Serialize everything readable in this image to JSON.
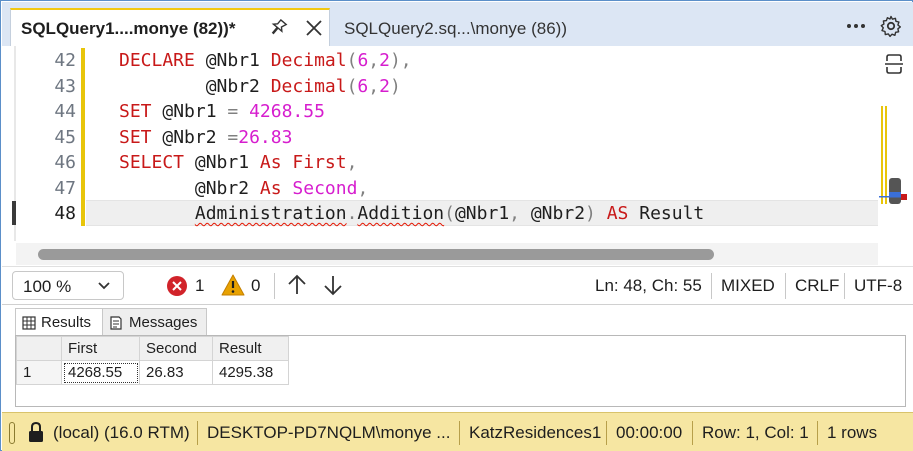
{
  "tabs": {
    "active": {
      "title": "SQLQuery1....monye (82))*"
    },
    "inactive": {
      "title": "SQLQuery2.sq...\\monye (86))"
    }
  },
  "icons": {
    "pin": "pin-icon",
    "close": "close-icon",
    "more": "more-options-icon",
    "settings": "gear-icon",
    "split": "split-editor-icon",
    "error": "error-icon",
    "warning": "warning-icon",
    "lock": "lock-icon"
  },
  "editor": {
    "line_numbers": [
      "42",
      "43",
      "44",
      "45",
      "46",
      "47",
      "48"
    ],
    "current_line": "48",
    "lines": [
      [
        {
          "t": "DECLARE ",
          "c": "kw"
        },
        {
          "t": "@Nbr1 "
        },
        {
          "t": "Decimal",
          "c": "kw"
        },
        {
          "t": "(",
          "c": "op"
        },
        {
          "t": "6",
          "c": "num"
        },
        {
          "t": ",",
          "c": "op"
        },
        {
          "t": "2",
          "c": "num"
        },
        {
          "t": "),",
          "c": "op"
        }
      ],
      [
        {
          "t": "        @Nbr2 "
        },
        {
          "t": "Decimal",
          "c": "kw"
        },
        {
          "t": "(",
          "c": "op"
        },
        {
          "t": "6",
          "c": "num"
        },
        {
          "t": ",",
          "c": "op"
        },
        {
          "t": "2",
          "c": "num"
        },
        {
          "t": ")",
          "c": "op"
        }
      ],
      [
        {
          "t": "SET ",
          "c": "kw"
        },
        {
          "t": "@Nbr1 "
        },
        {
          "t": "= ",
          "c": "op"
        },
        {
          "t": "4268.55",
          "c": "num"
        }
      ],
      [
        {
          "t": "SET ",
          "c": "kw"
        },
        {
          "t": "@Nbr2 "
        },
        {
          "t": "=",
          "c": "op"
        },
        {
          "t": "26.83",
          "c": "num"
        }
      ],
      [
        {
          "t": "SELECT ",
          "c": "kw"
        },
        {
          "t": "@Nbr1 "
        },
        {
          "t": "As ",
          "c": "kw"
        },
        {
          "t": "First",
          "c": "kw"
        },
        {
          "t": ",",
          "c": "op"
        }
      ],
      [
        {
          "t": "       @Nbr2 "
        },
        {
          "t": "As ",
          "c": "kw"
        },
        {
          "t": "Second",
          "c": "num"
        },
        {
          "t": ",",
          "c": "op"
        }
      ],
      [
        {
          "t": "       "
        },
        {
          "t": "Administration",
          "c": "sq"
        },
        {
          "t": ".",
          "c": "op"
        },
        {
          "t": "Addition",
          "c": "sq"
        },
        {
          "t": "(",
          "c": "op"
        },
        {
          "t": "@Nbr1"
        },
        {
          "t": ", ",
          "c": "op"
        },
        {
          "t": "@Nbr2"
        },
        {
          "t": ") ",
          "c": "op"
        },
        {
          "t": "AS ",
          "c": "kw"
        },
        {
          "t": "Result"
        }
      ]
    ]
  },
  "edit_status": {
    "zoom": "100 %",
    "errors": "1",
    "warnings": "0",
    "position": "Ln: 48, Ch: 55",
    "mode": "MIXED",
    "line_ending": "CRLF",
    "encoding": "UTF-8"
  },
  "results": {
    "tabs": [
      "Results",
      "Messages"
    ],
    "columns": [
      "First",
      "Second",
      "Result"
    ],
    "rows": [
      {
        "num": "1",
        "cells": [
          "4268.55",
          "26.83",
          "4295.38"
        ]
      }
    ]
  },
  "connection": {
    "server": "(local) (16.0 RTM)",
    "user": "DESKTOP-PD7NQLM\\monye ...",
    "database": "KatzResidences1",
    "elapsed": "00:00:00",
    "row_col": "Row: 1, Col: 1",
    "row_count": "1 rows"
  },
  "colors": {
    "tab_accent": "#f2c811",
    "change_bar": "#e8c50a",
    "status_bar": "#f6e6a2",
    "keyword": "#c81919",
    "number": "#d61dce"
  }
}
